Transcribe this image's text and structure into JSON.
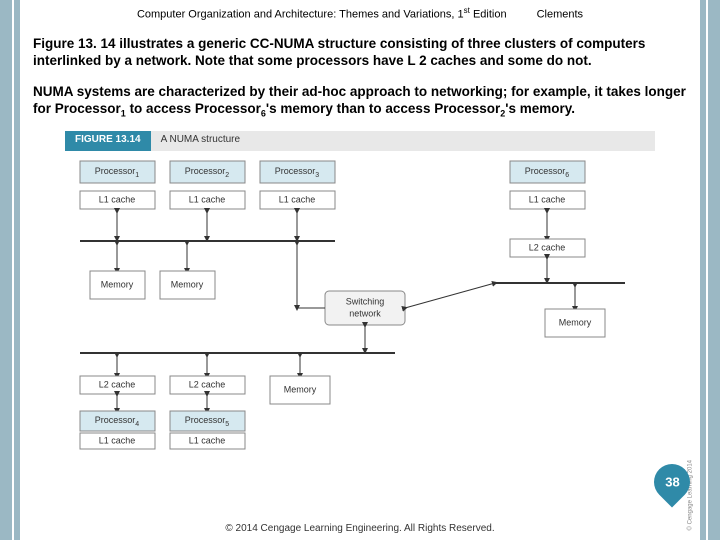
{
  "header": {
    "title_left": "Computer Organization and Architecture: Themes and Variations, 1",
    "title_sup": "st",
    "title_right": " Edition",
    "author": "Clements"
  },
  "para1": {
    "t1": "Figure 13. 14 illustrates a generic CC-NUMA structure consisting of three clusters of computers interlinked by a network. Note that some processors have L 2 caches and some do not."
  },
  "para2": {
    "t1": "NUMA systems are characterized by their ad-hoc approach to networking; for example, it takes longer for Processor",
    "s1": "1",
    "t2": " to access Processor",
    "s2": "6",
    "t3": "'s memory than to access Processor",
    "s3": "2",
    "t4": "'s memory."
  },
  "figure": {
    "tab": "FIGURE 13.14",
    "caption": "A NUMA structure",
    "processor": "Processor",
    "l1": "L1 cache",
    "l2": "L2 cache",
    "memory": "Memory",
    "switch": "Switching\nnetwork",
    "copyright_vert": "© Cengage Learning 2014"
  },
  "footer": {
    "text": "© 2014 Cengage Learning Engineering. All Rights Reserved."
  },
  "page_number": "38"
}
